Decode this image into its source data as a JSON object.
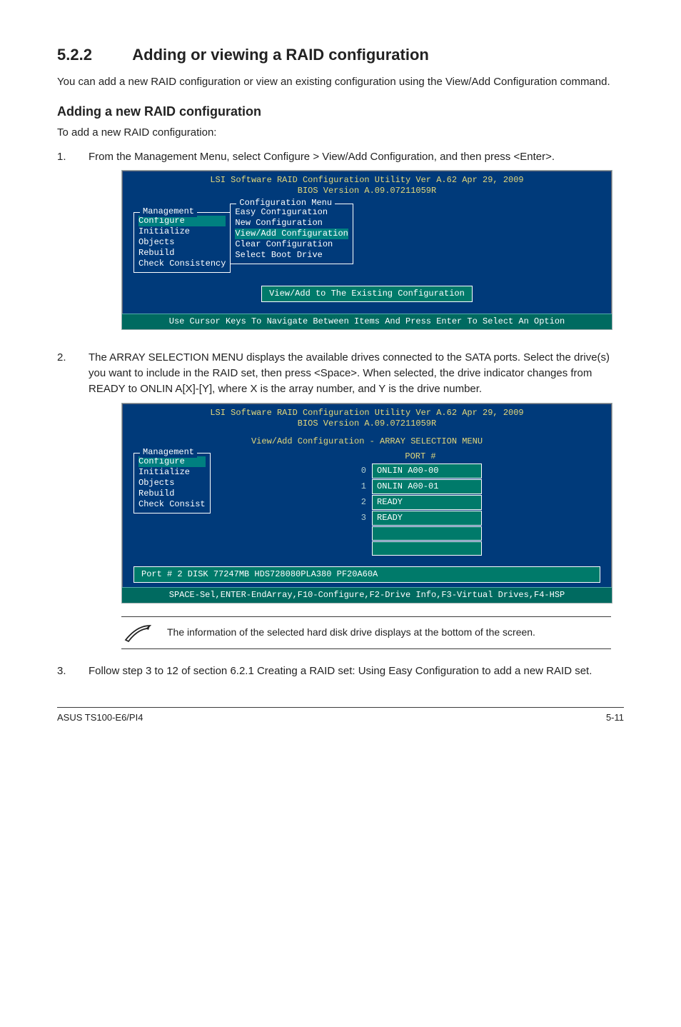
{
  "section": {
    "number": "5.2.2",
    "title": "Adding or viewing a RAID configuration",
    "intro": "You can add a new RAID configuration or view an existing configuration using the View/Add Configuration command.",
    "subheading": "Adding a new RAID configuration",
    "sublead": "To add a new RAID configuration:"
  },
  "steps": [
    {
      "num": "1.",
      "text": "From the Management Menu, select Configure > View/Add Configuration, and then press <Enter>."
    },
    {
      "num": "2.",
      "text": "The ARRAY SELECTION MENU displays the available drives connected to the SATA ports. Select the drive(s) you want to include in the RAID set, then press <Space>. When selected, the drive indicator changes from READY to ONLIN A[X]-[Y], where X is the array number, and Y is the drive number."
    },
    {
      "num": "3.",
      "text": "Follow step 3 to 12 of section 6.2.1 Creating a RAID set: Using Easy Configuration to add a new RAID set."
    }
  ],
  "bios1": {
    "title1": "LSI Software RAID Configuration Utility Ver A.62 Apr 29, 2009",
    "title2": "BIOS Version  A.09.07211059R",
    "mgmt_label": "Management",
    "mgmt_items": [
      "Configure",
      "Initialize",
      "Objects",
      "Rebuild",
      "Check Consistency"
    ],
    "cfg_label": "Configuration Menu",
    "cfg_items": [
      "Easy Configuration",
      "New Configuration",
      "View/Add Configuration",
      "Clear Configuration",
      "Select Boot Drive"
    ],
    "status_btn": "View/Add to The Existing Configuration",
    "footer": "Use Cursor Keys To Navigate Between Items And Press Enter To Select An Option"
  },
  "bios2": {
    "title1": "LSI Software RAID Configuration Utility Ver A.62 Apr 29, 2009",
    "title2": "BIOS Version  A.09.07211059R",
    "array_title": "View/Add Configuration - ARRAY SELECTION MENU",
    "mgmt_label": "Management",
    "mgmt_items": [
      "Configure",
      "Initialize",
      "Objects",
      "Rebuild",
      "Check Consist"
    ],
    "port_header": "PORT #",
    "ports": [
      {
        "idx": "0",
        "text": "ONLIN A00-00"
      },
      {
        "idx": "1",
        "text": "ONLIN A00-01"
      },
      {
        "idx": "2",
        "text": "READY"
      },
      {
        "idx": "3",
        "text": "READY"
      }
    ],
    "disk_bar": "Port # 2 DISK   77247MB   HDS728080PLA380   PF20A60A",
    "footer": "SPACE-Sel,ENTER-EndArray,F10-Configure,F2-Drive Info,F3-Virtual Drives,F4-HSP"
  },
  "note_text": "The information of the selected hard disk drive displays at the bottom of the screen.",
  "footer_left": "ASUS TS100-E6/PI4",
  "footer_right": "5-11"
}
